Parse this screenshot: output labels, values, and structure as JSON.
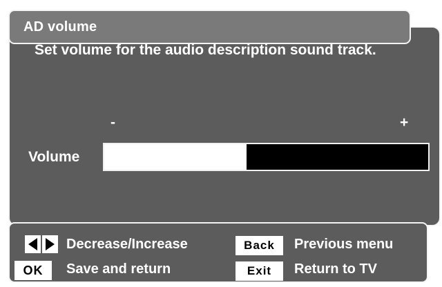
{
  "menu": {
    "title": "AD volume",
    "description": "Set volume for the audio description sound track.",
    "scale_min": "-",
    "scale_max": "+",
    "volume_label": "Volume",
    "volume_level": 0.44
  },
  "help": {
    "decrease_increase": "Decrease/Increase",
    "ok_key": "OK",
    "save_return": "Save and return",
    "back_key": "Back",
    "previous_menu": "Previous menu",
    "exit_key": "Exit",
    "return_tv": "Return to TV"
  },
  "icons": {
    "left": "left-arrow-icon",
    "right": "right-arrow-icon"
  },
  "colors": {
    "panel": "#5c5c5c",
    "title_bar": "#7a7a7a",
    "border": "#f4f4f4",
    "bar_fill": "#ffffff",
    "bar_bg": "#000000"
  }
}
